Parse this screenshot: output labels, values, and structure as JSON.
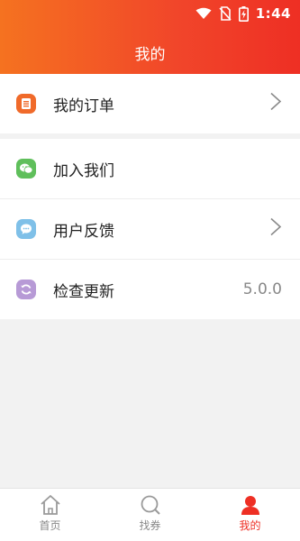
{
  "status": {
    "time": "1:44"
  },
  "header": {
    "title": "我的"
  },
  "menu": {
    "orders": {
      "label": "我的订单"
    },
    "join": {
      "label": "加入我们"
    },
    "feedback": {
      "label": "用户反馈"
    },
    "update": {
      "label": "检查更新",
      "version": "5.0.0"
    }
  },
  "tabs": [
    {
      "label": "首页",
      "icon": "home-icon",
      "active": false
    },
    {
      "label": "找券",
      "icon": "search-icon",
      "active": false
    },
    {
      "label": "我的",
      "icon": "profile-icon",
      "active": true
    }
  ],
  "colors": {
    "header_start": "#f57220",
    "header_end": "#ee2f24",
    "orders_icon": "#f06a2a",
    "join_icon": "#5fbf5b",
    "feedback_icon": "#7fc0e8",
    "update_icon": "#b79ad6",
    "active_tab": "#ee2f24"
  }
}
